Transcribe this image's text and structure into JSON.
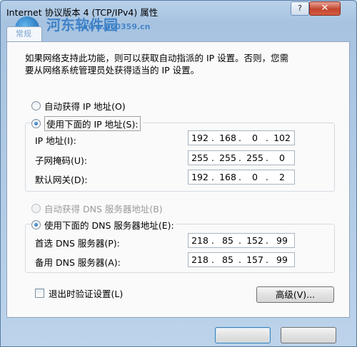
{
  "window": {
    "title": "Internet 协议版本 4 (TCP/IPv4) 属性",
    "help_label": "?",
    "close_label": "✕"
  },
  "watermark": {
    "text": "河东软件园",
    "url": "www.pc0359.cn"
  },
  "tab": {
    "label": "常规"
  },
  "description": {
    "line1": "如果网络支持此功能，则可以获取自动指派的 IP 设置。否则，您需",
    "line2": "要从网络系统管理员处获得适当的 IP 设置。"
  },
  "ip_mode": {
    "auto_label": "自动获得 IP 地址(O)",
    "manual_label": "使用下面的 IP 地址(S):",
    "selected": "manual"
  },
  "ip_fields": [
    {
      "label": "IP 地址(I):",
      "value": [
        "192",
        "168",
        "0",
        "102"
      ]
    },
    {
      "label": "子网掩码(U):",
      "value": [
        "255",
        "255",
        "255",
        "0"
      ]
    },
    {
      "label": "默认网关(D):",
      "value": [
        "192",
        "168",
        "0",
        "2"
      ]
    }
  ],
  "dns_mode": {
    "auto_label": "自动获得 DNS 服务器地址(B)",
    "manual_label": "使用下面的 DNS 服务器地址(E):",
    "selected": "manual"
  },
  "dns_fields": [
    {
      "label": "首选 DNS 服务器(P):",
      "value": [
        "218",
        "85",
        "152",
        "99"
      ]
    },
    {
      "label": "备用 DNS 服务器(A):",
      "value": [
        "218",
        "85",
        "157",
        "99"
      ]
    }
  ],
  "validate_on_exit": {
    "label": "退出时验证设置(L)",
    "checked": false
  },
  "buttons": {
    "advanced": "高级(V)...",
    "ok": "",
    "cancel": ""
  }
}
